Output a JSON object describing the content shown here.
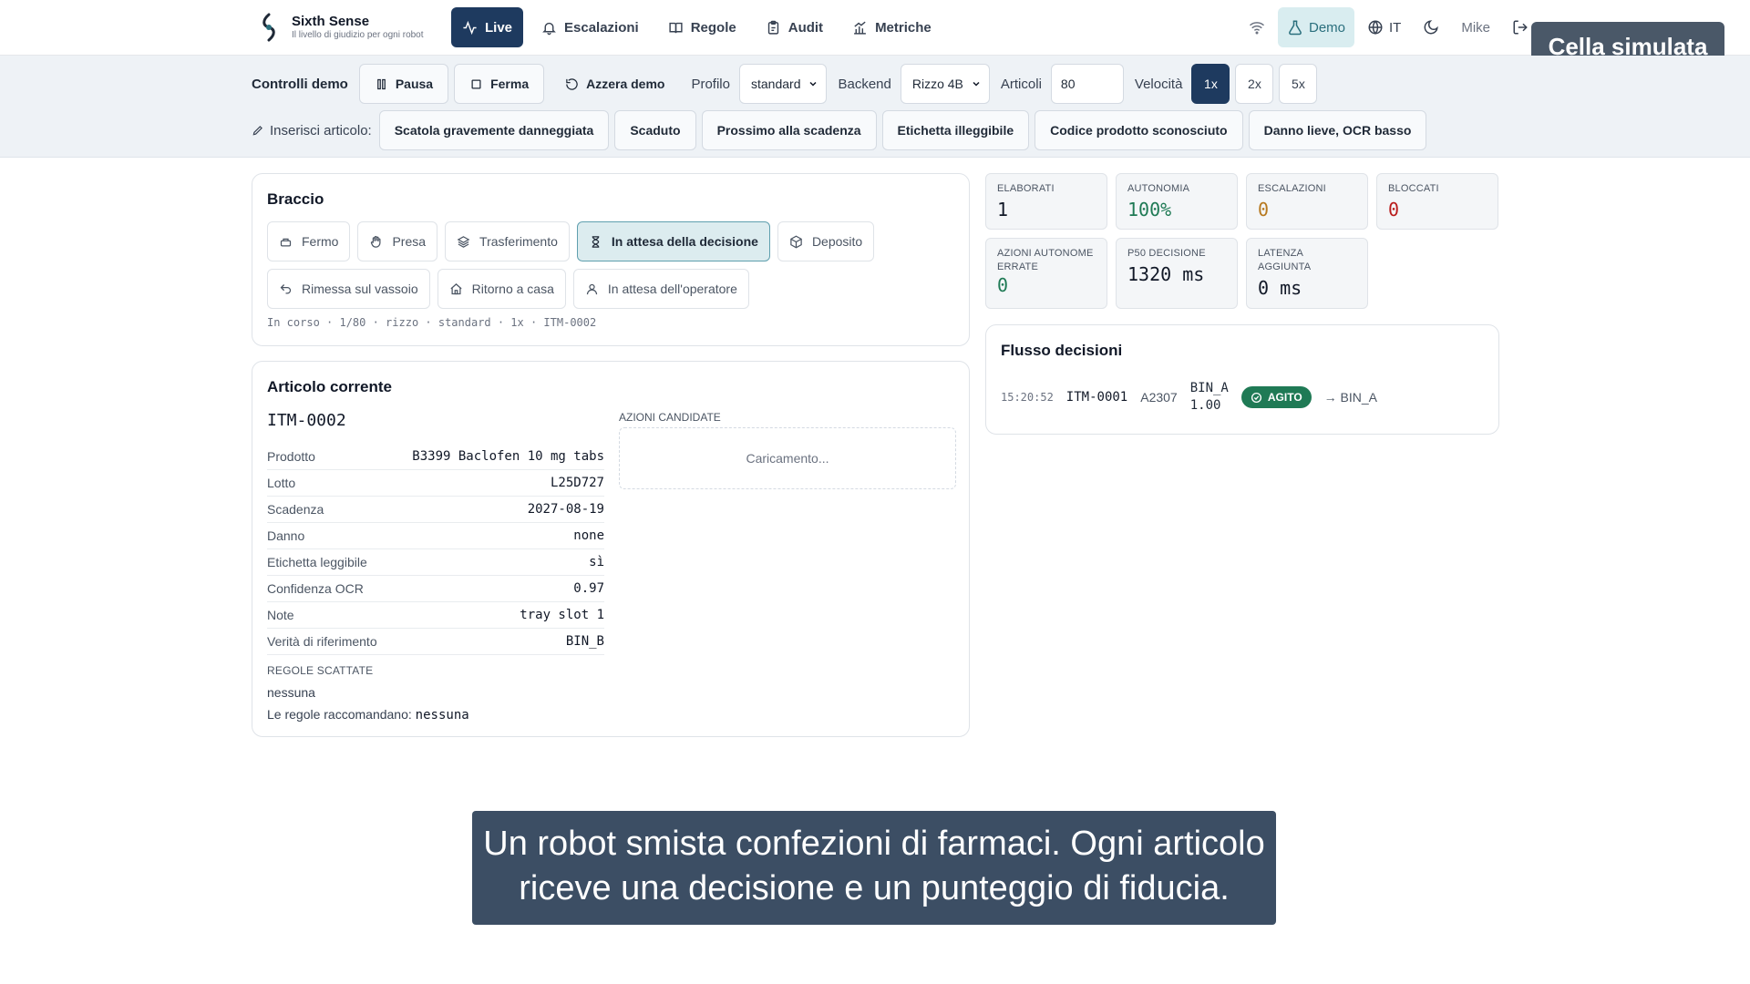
{
  "brand": {
    "name": "Sixth Sense",
    "tagline": "Il livello di giudizio per ogni robot"
  },
  "nav": {
    "items": [
      {
        "label": "Live",
        "icon": "activity-icon",
        "active": true
      },
      {
        "label": "Escalazioni",
        "icon": "bell-icon"
      },
      {
        "label": "Regole",
        "icon": "book-icon"
      },
      {
        "label": "Audit",
        "icon": "clipboard-icon"
      },
      {
        "label": "Metriche",
        "icon": "chart-icon"
      }
    ],
    "right": {
      "demo": "Demo",
      "language": "IT",
      "user": "Mike"
    }
  },
  "sim_badge": "Cella simulata",
  "controls": {
    "title": "Controlli demo",
    "pause": "Pausa",
    "stop": "Ferma",
    "reset": "Azzera demo",
    "profile_label": "Profilo",
    "profile_value": "standard",
    "backend_label": "Backend",
    "backend_value": "Rizzo 4B",
    "items_label": "Articoli",
    "items_value": "80",
    "speed_label": "Velocità",
    "speeds": [
      "1x",
      "2x",
      "5x"
    ],
    "speed_active": "1x"
  },
  "insert": {
    "label": "Inserisci articolo:",
    "options": [
      "Scatola gravemente danneggiata",
      "Scaduto",
      "Prossimo alla scadenza",
      "Etichetta illeggibile",
      "Codice prodotto sconosciuto",
      "Danno lieve, OCR basso"
    ]
  },
  "arm": {
    "title": "Braccio",
    "states": [
      {
        "label": "Fermo",
        "icon": "idle-icon"
      },
      {
        "label": "Presa",
        "icon": "hand-icon"
      },
      {
        "label": "Trasferimento",
        "icon": "layers-icon"
      },
      {
        "label": "In attesa della decisione",
        "icon": "hourglass-icon",
        "active": true
      },
      {
        "label": "Deposito",
        "icon": "package-icon"
      },
      {
        "label": "Rimessa sul vassoio",
        "icon": "undo-icon"
      },
      {
        "label": "Ritorno a casa",
        "icon": "home-icon"
      },
      {
        "label": "In attesa dell'operatore",
        "icon": "user-icon"
      }
    ],
    "status": "In corso · 1/80 · rizzo · standard · 1x · ITM-0002"
  },
  "current_item": {
    "title": "Articolo corrente",
    "id": "ITM-0002",
    "properties": [
      {
        "key": "Prodotto",
        "value": "B3399 Baclofen 10 mg tabs"
      },
      {
        "key": "Lotto",
        "value": "L25D727"
      },
      {
        "key": "Scadenza",
        "value": "2027-08-19"
      },
      {
        "key": "Danno",
        "value": "none"
      },
      {
        "key": "Etichetta leggibile",
        "value": "sì"
      },
      {
        "key": "Confidenza OCR",
        "value": "0.97"
      },
      {
        "key": "Note",
        "value": "tray slot 1"
      },
      {
        "key": "Verità di riferimento",
        "value": "BIN_B"
      }
    ],
    "rules_label": "REGOLE SCATTATE",
    "rules_value": "nessuna",
    "rules_rec_label": "Le regole raccomandano:",
    "rules_rec_value": "nessuna",
    "candidates_label": "AZIONI CANDIDATE",
    "candidates_loading": "Caricamento..."
  },
  "metrics": [
    {
      "label": "ELABORATI",
      "value": "1",
      "color": "#111827"
    },
    {
      "label": "AUTONOMIA",
      "value": "100%",
      "color": "#1f7a55"
    },
    {
      "label": "ESCALAZIONI",
      "value": "0",
      "color": "#b7791f"
    },
    {
      "label": "BLOCCATI",
      "value": "0",
      "color": "#b91c1c"
    },
    {
      "label": "AZIONI AUTONOME ERRATE",
      "value": "0",
      "color": "#1f7a55"
    },
    {
      "label": "P50 DECISIONE",
      "value": "1320 ms",
      "color": "#111827"
    },
    {
      "label": "LATENZA AGGIUNTA",
      "value": "0 ms",
      "color": "#111827"
    }
  ],
  "flow": {
    "title": "Flusso decisioni",
    "rows": [
      {
        "time": "15:20:52",
        "item": "ITM-0001",
        "code": "A2307",
        "bin": "BIN_A",
        "score": "1.00",
        "badge": "AGITO",
        "target": "BIN_A"
      }
    ]
  },
  "caption": "Un robot smista confezioni di farmaci. Ogni articolo riceve una decisione e un punteggio di fiducia.",
  "colors": {
    "primary": "#1e3a5f",
    "accent_teal": "#2a6f7d",
    "success": "#1f7a55",
    "warning": "#b7791f",
    "danger": "#b91c1c"
  }
}
